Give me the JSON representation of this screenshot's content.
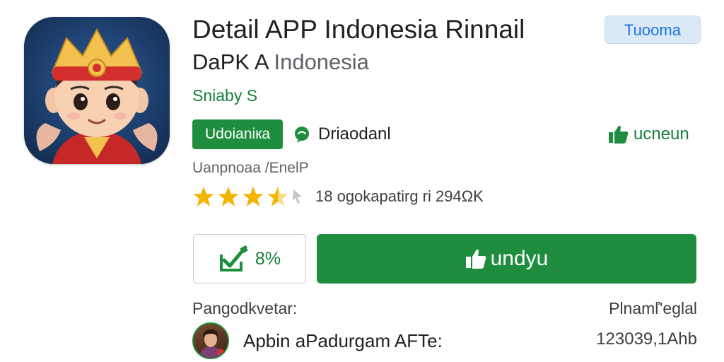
{
  "app": {
    "title": "Detail APP Indonesia Rinnail",
    "developer_primary": "DaPK A",
    "developer_secondary": " Indonesia",
    "badge": "Tuooma",
    "small_link": "Sniaby S",
    "category_chip": "Udoianiкa",
    "downloads_label": "Driaodanl",
    "review_label": "ucneun",
    "meta_line": "Uanpnoaa /EnelP",
    "rating": {
      "value": 3.5,
      "max": 5,
      "text": "18 ogokapatirg ri 294ΩK"
    }
  },
  "actions": {
    "wishlist_label": "8%",
    "install_label": "undyu"
  },
  "section": {
    "left_label": "Pangodkvetar:",
    "right_label": "Plnamľ'eglal"
  },
  "developer_row": {
    "name": "Apbin aPadurgam AFTe:",
    "count": "123039,1Ahb"
  },
  "colors": {
    "accent_green": "#1e8e3e",
    "link_green": "#188038",
    "badge_blue": "#1a73e8",
    "star_gold": "#f4b400"
  },
  "icons": {
    "app": "warrior-character-icon",
    "downloads": "chat-bubble-icon",
    "review": "thumbs-up-icon",
    "wishlist": "checkbox-edit-icon",
    "install": "thumbs-up-icon"
  }
}
